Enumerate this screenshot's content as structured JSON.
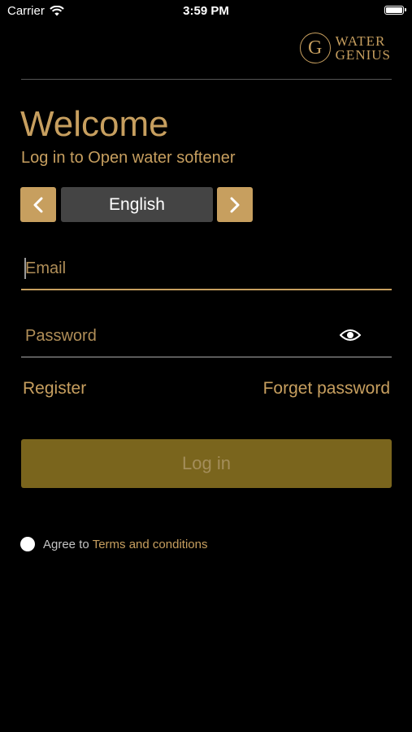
{
  "status_bar": {
    "carrier": "Carrier",
    "time": "3:59 PM",
    "icons": [
      "wifi-icon",
      "battery-icon"
    ]
  },
  "brand": {
    "logo_letter": "G",
    "line1": "WATER",
    "line2": "GENIUS"
  },
  "header": {
    "title": "Welcome",
    "subtitle": "Log in to Open water softener"
  },
  "language": {
    "selected": "English",
    "prev_icon": "chevron-left-icon",
    "next_icon": "chevron-right-icon"
  },
  "form": {
    "email_placeholder": "Email",
    "email_value": "",
    "password_placeholder": "Password",
    "password_value": "",
    "password_toggle_icon": "eye-icon"
  },
  "links": {
    "register": "Register",
    "forget_password": "Forget password"
  },
  "login_button": "Log in",
  "agreement": {
    "prefix": "Agree to",
    "link": "Terms and conditions",
    "checked": false
  },
  "colors": {
    "accent": "#c79f5f",
    "login_button": "#7a651d",
    "background": "#000000",
    "language_display": "#444444"
  }
}
